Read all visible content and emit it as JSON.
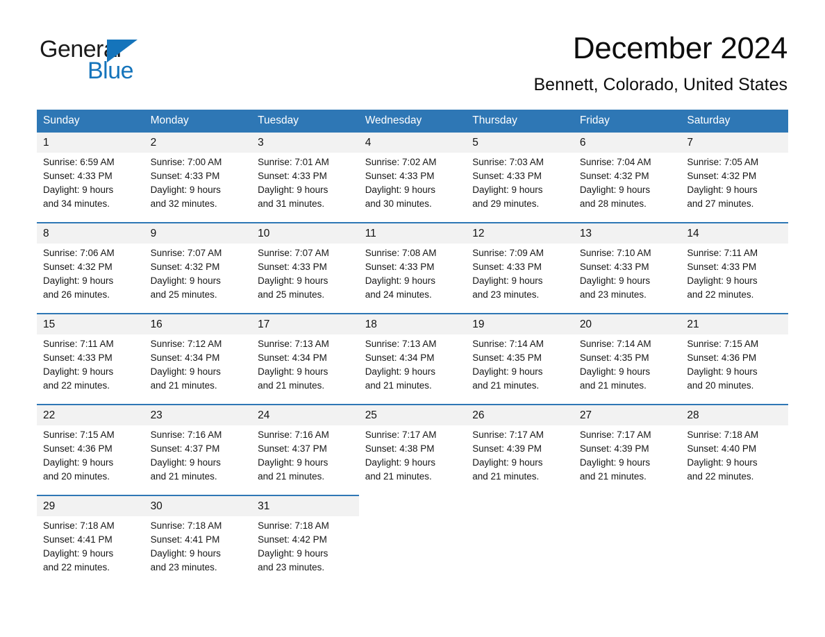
{
  "logo": {
    "word1": "General",
    "word2": "Blue",
    "triangle_color": "#1574bb"
  },
  "header": {
    "month_title": "December 2024",
    "location": "Bennett, Colorado, United States"
  },
  "theme": {
    "header_blue": "#2e77b5",
    "daynum_band": "#f2f2f2",
    "text": "#161616"
  },
  "calendar": {
    "weekday_headers": [
      "Sunday",
      "Monday",
      "Tuesday",
      "Wednesday",
      "Thursday",
      "Friday",
      "Saturday"
    ],
    "weeks": [
      [
        {
          "day": "1",
          "lines": [
            "Sunrise: 6:59 AM",
            "Sunset: 4:33 PM",
            "Daylight: 9 hours",
            "and 34 minutes."
          ]
        },
        {
          "day": "2",
          "lines": [
            "Sunrise: 7:00 AM",
            "Sunset: 4:33 PM",
            "Daylight: 9 hours",
            "and 32 minutes."
          ]
        },
        {
          "day": "3",
          "lines": [
            "Sunrise: 7:01 AM",
            "Sunset: 4:33 PM",
            "Daylight: 9 hours",
            "and 31 minutes."
          ]
        },
        {
          "day": "4",
          "lines": [
            "Sunrise: 7:02 AM",
            "Sunset: 4:33 PM",
            "Daylight: 9 hours",
            "and 30 minutes."
          ]
        },
        {
          "day": "5",
          "lines": [
            "Sunrise: 7:03 AM",
            "Sunset: 4:33 PM",
            "Daylight: 9 hours",
            "and 29 minutes."
          ]
        },
        {
          "day": "6",
          "lines": [
            "Sunrise: 7:04 AM",
            "Sunset: 4:32 PM",
            "Daylight: 9 hours",
            "and 28 minutes."
          ]
        },
        {
          "day": "7",
          "lines": [
            "Sunrise: 7:05 AM",
            "Sunset: 4:32 PM",
            "Daylight: 9 hours",
            "and 27 minutes."
          ]
        }
      ],
      [
        {
          "day": "8",
          "lines": [
            "Sunrise: 7:06 AM",
            "Sunset: 4:32 PM",
            "Daylight: 9 hours",
            "and 26 minutes."
          ]
        },
        {
          "day": "9",
          "lines": [
            "Sunrise: 7:07 AM",
            "Sunset: 4:32 PM",
            "Daylight: 9 hours",
            "and 25 minutes."
          ]
        },
        {
          "day": "10",
          "lines": [
            "Sunrise: 7:07 AM",
            "Sunset: 4:33 PM",
            "Daylight: 9 hours",
            "and 25 minutes."
          ]
        },
        {
          "day": "11",
          "lines": [
            "Sunrise: 7:08 AM",
            "Sunset: 4:33 PM",
            "Daylight: 9 hours",
            "and 24 minutes."
          ]
        },
        {
          "day": "12",
          "lines": [
            "Sunrise: 7:09 AM",
            "Sunset: 4:33 PM",
            "Daylight: 9 hours",
            "and 23 minutes."
          ]
        },
        {
          "day": "13",
          "lines": [
            "Sunrise: 7:10 AM",
            "Sunset: 4:33 PM",
            "Daylight: 9 hours",
            "and 23 minutes."
          ]
        },
        {
          "day": "14",
          "lines": [
            "Sunrise: 7:11 AM",
            "Sunset: 4:33 PM",
            "Daylight: 9 hours",
            "and 22 minutes."
          ]
        }
      ],
      [
        {
          "day": "15",
          "lines": [
            "Sunrise: 7:11 AM",
            "Sunset: 4:33 PM",
            "Daylight: 9 hours",
            "and 22 minutes."
          ]
        },
        {
          "day": "16",
          "lines": [
            "Sunrise: 7:12 AM",
            "Sunset: 4:34 PM",
            "Daylight: 9 hours",
            "and 21 minutes."
          ]
        },
        {
          "day": "17",
          "lines": [
            "Sunrise: 7:13 AM",
            "Sunset: 4:34 PM",
            "Daylight: 9 hours",
            "and 21 minutes."
          ]
        },
        {
          "day": "18",
          "lines": [
            "Sunrise: 7:13 AM",
            "Sunset: 4:34 PM",
            "Daylight: 9 hours",
            "and 21 minutes."
          ]
        },
        {
          "day": "19",
          "lines": [
            "Sunrise: 7:14 AM",
            "Sunset: 4:35 PM",
            "Daylight: 9 hours",
            "and 21 minutes."
          ]
        },
        {
          "day": "20",
          "lines": [
            "Sunrise: 7:14 AM",
            "Sunset: 4:35 PM",
            "Daylight: 9 hours",
            "and 21 minutes."
          ]
        },
        {
          "day": "21",
          "lines": [
            "Sunrise: 7:15 AM",
            "Sunset: 4:36 PM",
            "Daylight: 9 hours",
            "and 20 minutes."
          ]
        }
      ],
      [
        {
          "day": "22",
          "lines": [
            "Sunrise: 7:15 AM",
            "Sunset: 4:36 PM",
            "Daylight: 9 hours",
            "and 20 minutes."
          ]
        },
        {
          "day": "23",
          "lines": [
            "Sunrise: 7:16 AM",
            "Sunset: 4:37 PM",
            "Daylight: 9 hours",
            "and 21 minutes."
          ]
        },
        {
          "day": "24",
          "lines": [
            "Sunrise: 7:16 AM",
            "Sunset: 4:37 PM",
            "Daylight: 9 hours",
            "and 21 minutes."
          ]
        },
        {
          "day": "25",
          "lines": [
            "Sunrise: 7:17 AM",
            "Sunset: 4:38 PM",
            "Daylight: 9 hours",
            "and 21 minutes."
          ]
        },
        {
          "day": "26",
          "lines": [
            "Sunrise: 7:17 AM",
            "Sunset: 4:39 PM",
            "Daylight: 9 hours",
            "and 21 minutes."
          ]
        },
        {
          "day": "27",
          "lines": [
            "Sunrise: 7:17 AM",
            "Sunset: 4:39 PM",
            "Daylight: 9 hours",
            "and 21 minutes."
          ]
        },
        {
          "day": "28",
          "lines": [
            "Sunrise: 7:18 AM",
            "Sunset: 4:40 PM",
            "Daylight: 9 hours",
            "and 22 minutes."
          ]
        }
      ],
      [
        {
          "day": "29",
          "lines": [
            "Sunrise: 7:18 AM",
            "Sunset: 4:41 PM",
            "Daylight: 9 hours",
            "and 22 minutes."
          ]
        },
        {
          "day": "30",
          "lines": [
            "Sunrise: 7:18 AM",
            "Sunset: 4:41 PM",
            "Daylight: 9 hours",
            "and 23 minutes."
          ]
        },
        {
          "day": "31",
          "lines": [
            "Sunrise: 7:18 AM",
            "Sunset: 4:42 PM",
            "Daylight: 9 hours",
            "and 23 minutes."
          ]
        },
        null,
        null,
        null,
        null
      ]
    ]
  }
}
